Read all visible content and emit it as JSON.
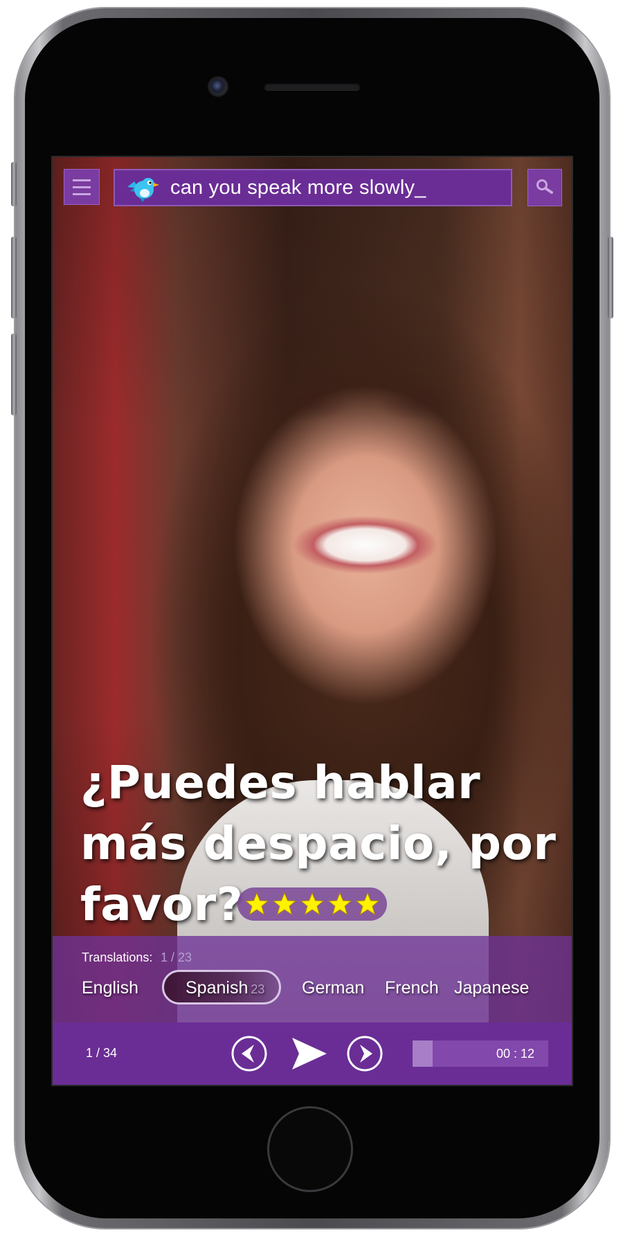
{
  "search": {
    "query": "can you speak more slowly_"
  },
  "phrase": {
    "text": "¿Puedes hablar más despacio, por favor?"
  },
  "rating": {
    "stars": 5,
    "max": 5
  },
  "translations": {
    "label": "Translations:",
    "count": "1 / 23",
    "languages": [
      {
        "name": "English",
        "badge": ""
      },
      {
        "name": "Spanish",
        "badge": "23"
      },
      {
        "name": "German",
        "badge": ""
      },
      {
        "name": "French",
        "badge": ""
      },
      {
        "name": "Japanese",
        "badge": ""
      }
    ],
    "selected": "Spanish"
  },
  "controls": {
    "page_counter": "1 / 34",
    "time": "00 : 12",
    "progress": 0.15
  },
  "icons": {
    "menu": "menu-icon",
    "app_logo": "bird-logo-icon",
    "search": "search-icon",
    "previous": "chevron-left-icon",
    "play": "play-icon",
    "next": "chevron-right-icon",
    "star": "star-icon"
  },
  "colors": {
    "brand_purple": "#6a2d95",
    "button_purple": "#7a3ca0",
    "star_yellow": "#fff200"
  }
}
